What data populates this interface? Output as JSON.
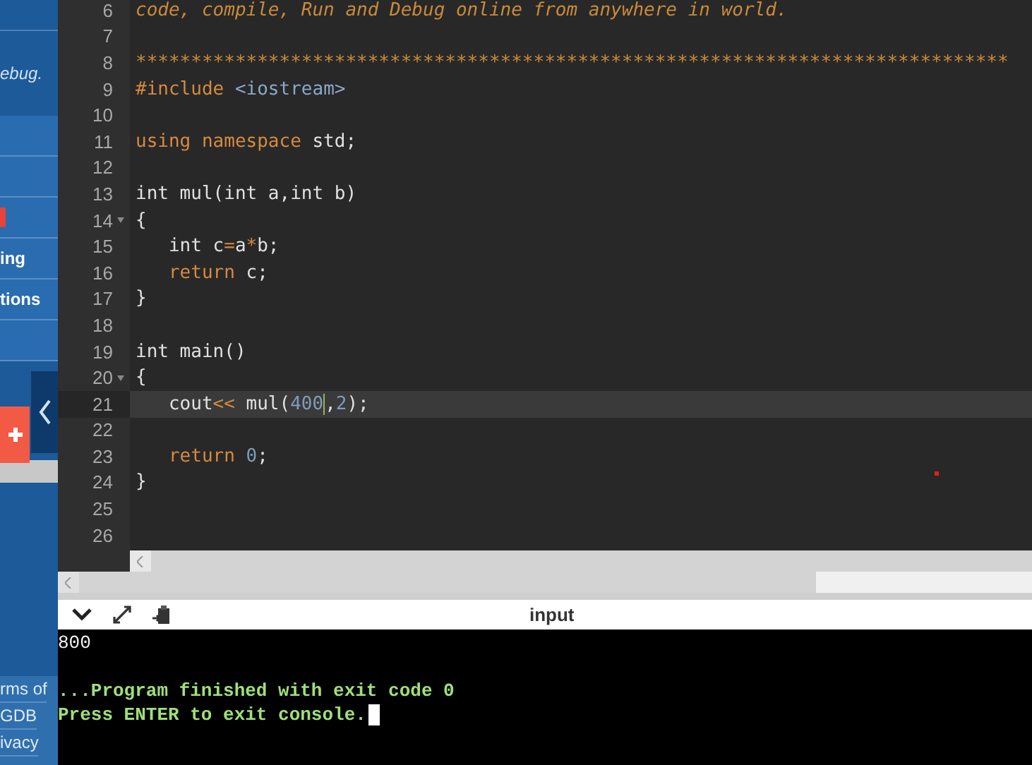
{
  "sidebar": {
    "tagline": "ebug.",
    "items": [
      {
        "kind": "plain"
      },
      {
        "kind": "plain"
      },
      {
        "kind": "badge"
      },
      {
        "label": "ing",
        "kind": "plain"
      },
      {
        "label": "tions",
        "kind": "plain"
      },
      {
        "kind": "plain"
      }
    ],
    "footer_links": [
      "rms of",
      "GDB",
      "ivacy"
    ]
  },
  "editor": {
    "lines": [
      {
        "number": "6",
        "fold": false,
        "active": false,
        "tokens": [
          {
            "text": "code, compile, Run and Debug online from anywhere in world.",
            "kind": "comment"
          }
        ]
      },
      {
        "number": "7",
        "fold": false,
        "active": false
      },
      {
        "number": "8",
        "fold": false,
        "active": false,
        "tokens": [
          {
            "text": "*******************************************************************************",
            "kind": "comment"
          }
        ]
      },
      {
        "number": "9",
        "fold": false,
        "active": false,
        "tokens": [
          {
            "text": "#include ",
            "kind": "keyword"
          },
          {
            "text": "<iostream>",
            "kind": "header"
          }
        ]
      },
      {
        "number": "10",
        "fold": false,
        "active": false
      },
      {
        "number": "11",
        "fold": false,
        "active": false,
        "tokens": [
          {
            "text": "using namespace",
            "kind": "keyword"
          },
          {
            "text": " std;",
            "kind": "plain"
          }
        ]
      },
      {
        "number": "12",
        "fold": false,
        "active": false
      },
      {
        "number": "13",
        "fold": false,
        "active": false,
        "tokens": [
          {
            "text": "int mul(int a,int b)",
            "kind": "plain"
          }
        ]
      },
      {
        "number": "14",
        "fold": true,
        "active": false,
        "tokens": [
          {
            "text": "{",
            "kind": "plain"
          }
        ]
      },
      {
        "number": "15",
        "fold": false,
        "active": false,
        "tokens": [
          {
            "text": "   int c",
            "kind": "plain"
          },
          {
            "text": "=",
            "kind": "operator"
          },
          {
            "text": "a",
            "kind": "plain"
          },
          {
            "text": "*",
            "kind": "operator"
          },
          {
            "text": "b;",
            "kind": "plain"
          }
        ]
      },
      {
        "number": "16",
        "fold": false,
        "active": false,
        "tokens": [
          {
            "text": "   return",
            "kind": "keyword"
          },
          {
            "text": " c;",
            "kind": "plain"
          }
        ]
      },
      {
        "number": "17",
        "fold": false,
        "active": false,
        "tokens": [
          {
            "text": "}",
            "kind": "plain"
          }
        ]
      },
      {
        "number": "18",
        "fold": false,
        "active": false
      },
      {
        "number": "19",
        "fold": false,
        "active": false,
        "tokens": [
          {
            "text": "int main()",
            "kind": "plain"
          }
        ]
      },
      {
        "number": "20",
        "fold": true,
        "active": false,
        "tokens": [
          {
            "text": "{",
            "kind": "plain"
          }
        ]
      },
      {
        "number": "21",
        "fold": false,
        "active": true,
        "tokens": [
          {
            "text": "   cout",
            "kind": "plain"
          },
          {
            "text": "<<",
            "kind": "operator"
          },
          {
            "text": " mul(",
            "kind": "plain"
          },
          {
            "text": "400",
            "kind": "number"
          },
          {
            "kind": "cursor"
          },
          {
            "text": ",",
            "kind": "plain"
          },
          {
            "text": "2",
            "kind": "number"
          },
          {
            "text": ");",
            "kind": "plain"
          }
        ]
      },
      {
        "number": "22",
        "fold": false,
        "active": false
      },
      {
        "number": "23",
        "fold": false,
        "active": false,
        "tokens": [
          {
            "text": "   return",
            "kind": "keyword"
          },
          {
            "text": " 0",
            "kind": "number"
          },
          {
            "text": ";",
            "kind": "plain"
          }
        ]
      },
      {
        "number": "24",
        "fold": false,
        "active": false,
        "tokens": [
          {
            "text": "}",
            "kind": "plain"
          }
        ]
      },
      {
        "number": "25",
        "fold": false,
        "active": false
      },
      {
        "number": "26",
        "fold": false,
        "active": false
      }
    ]
  },
  "console": {
    "title": "input",
    "output": [
      {
        "text": "800",
        "kind": "stdout"
      },
      {
        "kind": "blank"
      },
      {
        "text": "...Program finished with exit code 0",
        "kind": "status"
      },
      {
        "text": "Press ENTER to exit console.",
        "kind": "prompt"
      }
    ]
  }
}
